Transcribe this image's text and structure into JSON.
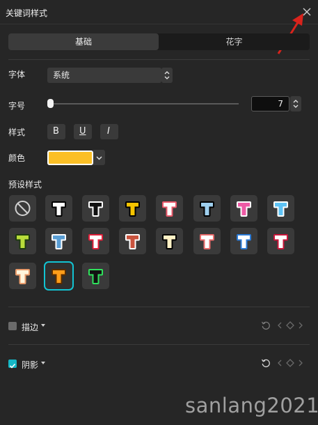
{
  "window": {
    "title": "关键词样式"
  },
  "tabs": [
    {
      "label": "基础",
      "active": true
    },
    {
      "label": "花字",
      "active": false
    }
  ],
  "font": {
    "label": "字体",
    "value": "系统"
  },
  "size": {
    "label": "字号",
    "value": "7"
  },
  "style": {
    "label": "样式",
    "bold": "B",
    "underline": "U",
    "italic": "I"
  },
  "color": {
    "label": "颜色",
    "value": "#fbbf26"
  },
  "presets": {
    "label": "预设样式",
    "items": [
      {
        "name": "none",
        "icon": "no-style-icon"
      },
      {
        "name": "white-black-outline",
        "fill": "#ffffff",
        "stroke": "#000000"
      },
      {
        "name": "black-white-outline",
        "fill": "#111111",
        "stroke": "#ffffff"
      },
      {
        "name": "yellow-black-outline",
        "fill": "#f6c400",
        "stroke": "#000000"
      },
      {
        "name": "white-pink-outline",
        "fill": "#ffffff",
        "stroke": "#e8586a"
      },
      {
        "name": "lightblue-black-outline",
        "fill": "#9fd0ef",
        "stroke": "#000000"
      },
      {
        "name": "pink-white-outline",
        "fill": "#ee5aa5",
        "stroke": "#ffffff"
      },
      {
        "name": "blue-white-outline",
        "fill": "#5ec3f5",
        "stroke": "#ffffff"
      },
      {
        "name": "lime-dark-outline",
        "fill": "#b9dd3b",
        "stroke": "#1e3a10"
      },
      {
        "name": "steelblue-white-outline",
        "fill": "#5a9ed4",
        "stroke": "#ffffff"
      },
      {
        "name": "white-red-outline",
        "fill": "#ffffff",
        "stroke": "#e0203a"
      },
      {
        "name": "brown-white-outline",
        "fill": "#c8533e",
        "stroke": "#ffffff"
      },
      {
        "name": "cream-dark-outline",
        "fill": "#fff2c6",
        "stroke": "#000000"
      },
      {
        "name": "white-salmon-outline",
        "fill": "#ffffff",
        "stroke": "#e66a6a"
      },
      {
        "name": "white-blue-3d",
        "fill": "#ffffff",
        "stroke": "#2a7ad6"
      },
      {
        "name": "white-crimson-3d",
        "fill": "#ffffff",
        "stroke": "#c8163a"
      },
      {
        "name": "cream-orange-3d",
        "fill": "#fff5dc",
        "stroke": "#e89a6a"
      },
      {
        "name": "orange-gradient",
        "fill": "#ff9d1a",
        "stroke": "#5a2d00",
        "selected": true
      },
      {
        "name": "black-green-outline",
        "fill": "#111111",
        "stroke": "#2fe25c"
      }
    ]
  },
  "stroke": {
    "label": "描边",
    "checked": false
  },
  "shadow": {
    "label": "阴影",
    "checked": true
  },
  "watermark": "sanlang2021"
}
